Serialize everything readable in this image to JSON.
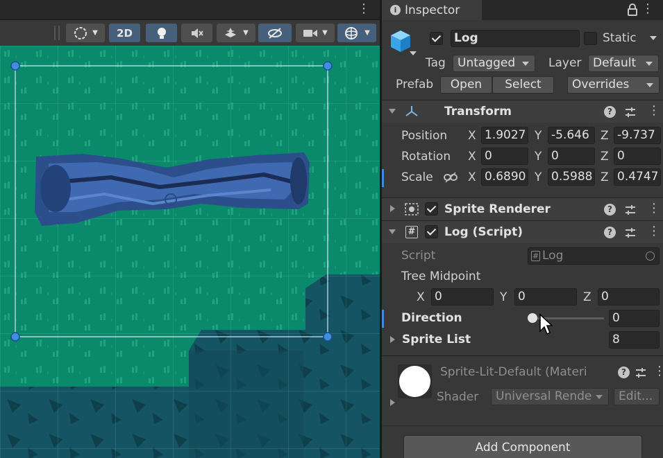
{
  "scene": {
    "toolbar": {
      "toggle_2d": "2D"
    }
  },
  "inspector": {
    "tab_title": "Inspector",
    "object": {
      "name": "Log",
      "active": true,
      "static_label": "Static",
      "static_checked": false,
      "tag_label": "Tag",
      "tag_value": "Untagged",
      "layer_label": "Layer",
      "layer_value": "Default",
      "prefab_label": "Prefab",
      "prefab_open": "Open",
      "prefab_select": "Select",
      "prefab_overrides": "Overrides"
    },
    "transform": {
      "title": "Transform",
      "position_label": "Position",
      "rotation_label": "Rotation",
      "scale_label": "Scale",
      "axis_x": "X",
      "axis_y": "Y",
      "axis_z": "Z",
      "position": {
        "x": "1.9027",
        "y": "-5.646",
        "z": "-9.737"
      },
      "rotation": {
        "x": "0",
        "y": "0",
        "z": "0"
      },
      "scale": {
        "x": "0.6890",
        "y": "0.5988",
        "z": "0.4747"
      }
    },
    "sprite_renderer": {
      "title": "Sprite Renderer",
      "enabled": true
    },
    "log_script": {
      "title": "Log (Script)",
      "enabled": true,
      "script_label": "Script",
      "script_value": "Log",
      "tree_midpoint_label": "Tree Midpoint",
      "tree_midpoint": {
        "x": "0",
        "y": "0",
        "z": "0"
      },
      "direction_label": "Direction",
      "direction_value": "0",
      "sprite_list_label": "Sprite List",
      "sprite_list_count": "8"
    },
    "material": {
      "name": "Sprite-Lit-Default (Materi",
      "shader_label": "Shader",
      "shader_value": "Universal Rende",
      "edit_label": "Edit..."
    },
    "add_component": "Add Component"
  },
  "colors": {
    "grass": "#0b8a6b",
    "water_dark": "#124b58",
    "log_blue": "#3a62a8",
    "selection_handle": "#3f8fe0",
    "accent_blue": "#46607c"
  },
  "icons": [
    "gizmo-orbit-icon",
    "lightbulb-icon",
    "audio-mute-icon",
    "effects-icon",
    "hidden-eye-icon",
    "camera-icon",
    "gizmo-sphere-icon",
    "info-icon",
    "lock-icon",
    "cube-icon",
    "transform-icon",
    "sprite-renderer-icon",
    "script-icon",
    "help-icon",
    "preset-icon",
    "link-icon"
  ]
}
